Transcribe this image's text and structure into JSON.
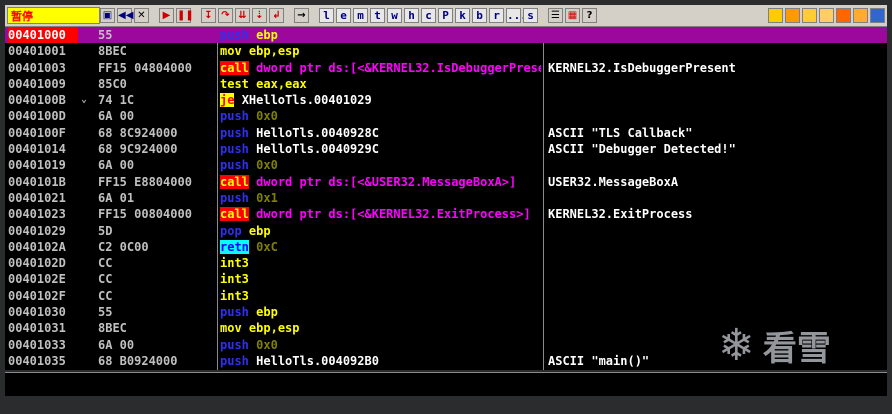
{
  "status": "暂停",
  "toolbar": {
    "letters": [
      "l",
      "e",
      "m",
      "t",
      "w",
      "h",
      "c",
      "P",
      "k",
      "b",
      "r",
      "...",
      "s"
    ]
  },
  "disasm": {
    "rows": [
      {
        "addr": "00401000",
        "hex": "55",
        "mnemonic": "push",
        "args": "ebp",
        "comment": "",
        "selected": true
      },
      {
        "addr": "00401001",
        "hex": "8BEC",
        "mnemonic": "mov",
        "args": "ebp,esp",
        "comment": ""
      },
      {
        "addr": "00401003",
        "hex": "FF15 04804000",
        "mnemonic": "call",
        "args": "dword ptr ds:[<&KERNEL32.IsDebuggerPresent>]",
        "comment": "KERNEL32.IsDebuggerPresent"
      },
      {
        "addr": "00401009",
        "hex": "85C0",
        "mnemonic": "test",
        "args": "eax,eax",
        "comment": ""
      },
      {
        "addr": "0040100B",
        "hex": "74 1C",
        "mnemonic": "je",
        "args": "XHelloTls.00401029",
        "comment": "",
        "mark": "⌄"
      },
      {
        "addr": "0040100D",
        "hex": "6A 00",
        "mnemonic": "push",
        "args": "0x0",
        "comment": ""
      },
      {
        "addr": "0040100F",
        "hex": "68 8C924000",
        "mnemonic": "push",
        "args": "HelloTls.0040928C",
        "comment": "ASCII \"TLS Callback\""
      },
      {
        "addr": "00401014",
        "hex": "68 9C924000",
        "mnemonic": "push",
        "args": "HelloTls.0040929C",
        "comment": "ASCII \"Debugger Detected!\""
      },
      {
        "addr": "00401019",
        "hex": "6A 00",
        "mnemonic": "push",
        "args": "0x0",
        "comment": ""
      },
      {
        "addr": "0040101B",
        "hex": "FF15 E8804000",
        "mnemonic": "call",
        "args": "dword ptr ds:[<&USER32.MessageBoxA>]",
        "comment": "USER32.MessageBoxA"
      },
      {
        "addr": "00401021",
        "hex": "6A 01",
        "mnemonic": "push",
        "args": "0x1",
        "comment": ""
      },
      {
        "addr": "00401023",
        "hex": "FF15 00804000",
        "mnemonic": "call",
        "args": "dword ptr ds:[<&KERNEL32.ExitProcess>]",
        "comment": "KERNEL32.ExitProcess"
      },
      {
        "addr": "00401029",
        "hex": "5D",
        "mnemonic": "pop",
        "args": "ebp",
        "comment": ""
      },
      {
        "addr": "0040102A",
        "hex": "C2 0C00",
        "mnemonic": "retn",
        "args": "0xC",
        "comment": ""
      },
      {
        "addr": "0040102D",
        "hex": "CC",
        "mnemonic": "int3",
        "args": "",
        "comment": ""
      },
      {
        "addr": "0040102E",
        "hex": "CC",
        "mnemonic": "int3",
        "args": "",
        "comment": ""
      },
      {
        "addr": "0040102F",
        "hex": "CC",
        "mnemonic": "int3",
        "args": "",
        "comment": ""
      },
      {
        "addr": "00401030",
        "hex": "55",
        "mnemonic": "push",
        "args": "ebp",
        "comment": ""
      },
      {
        "addr": "00401031",
        "hex": "8BEC",
        "mnemonic": "mov",
        "args": "ebp,esp",
        "comment": ""
      },
      {
        "addr": "00401033",
        "hex": "6A 00",
        "mnemonic": "push",
        "args": "0x0",
        "comment": ""
      },
      {
        "addr": "00401035",
        "hex": "68 B0924000",
        "mnemonic": "push",
        "args": "HelloTls.004092B0",
        "comment": "ASCII \"main()\""
      }
    ]
  },
  "watermark": "看雪"
}
